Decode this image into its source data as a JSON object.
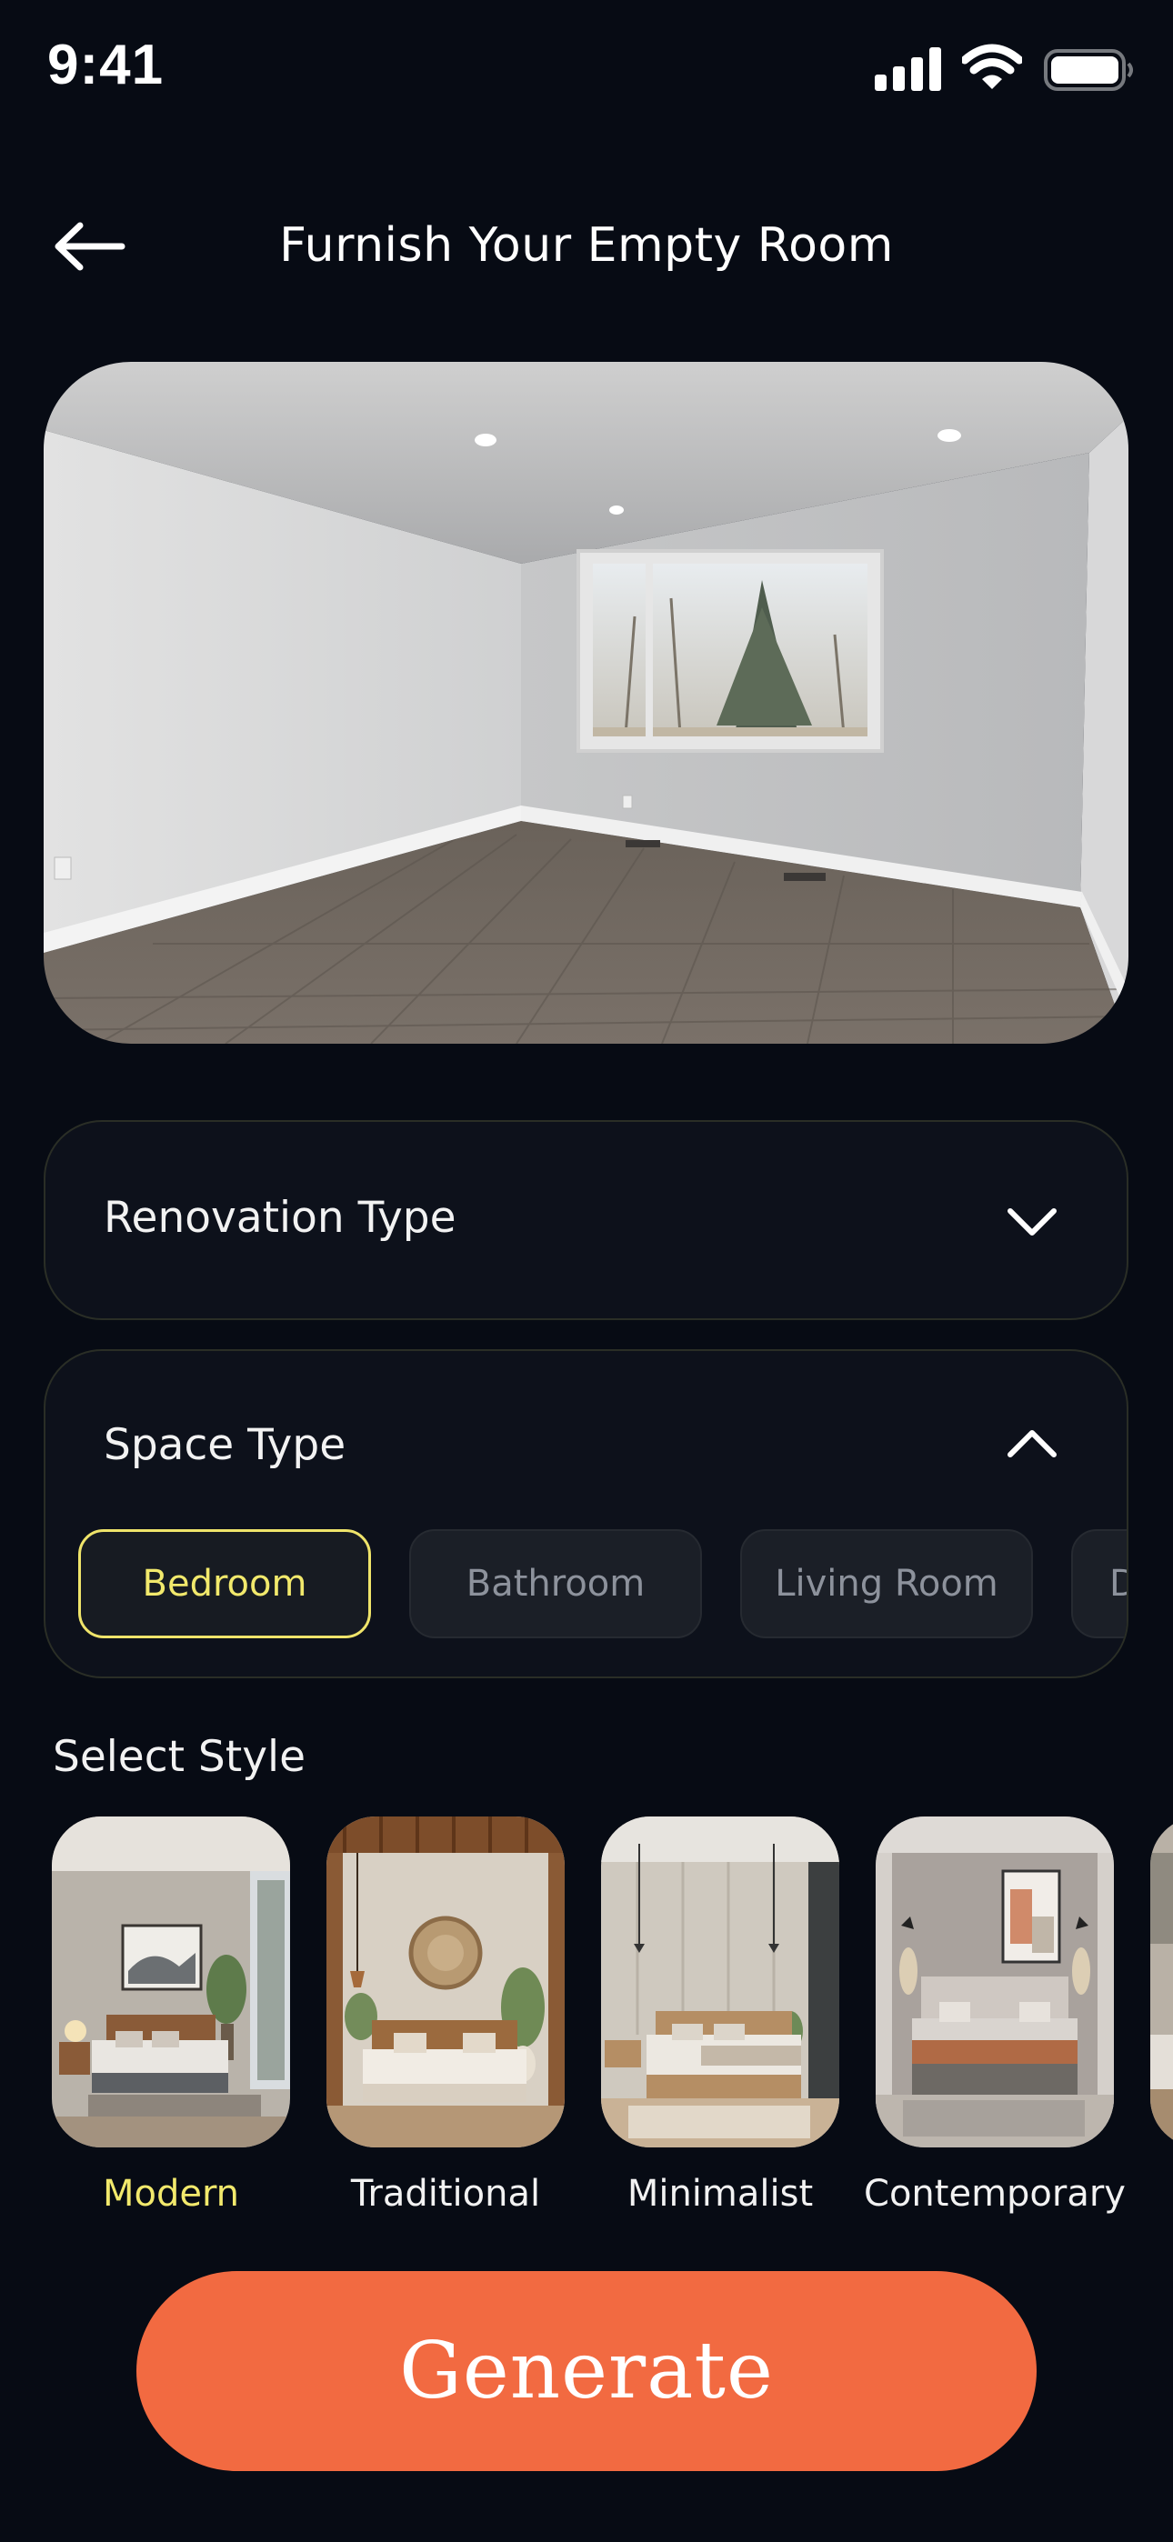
{
  "status_bar": {
    "time": "9:41"
  },
  "header": {
    "title": "Furnish Your Empty Room"
  },
  "renovation": {
    "label": "Renovation Type",
    "expanded": false
  },
  "space": {
    "label": "Space Type",
    "expanded": true,
    "options": [
      "Bedroom",
      "Bathroom",
      "Living Room",
      "D"
    ],
    "selected": "Bedroom"
  },
  "styles": {
    "title": "Select Style",
    "items": [
      {
        "label": "Modern"
      },
      {
        "label": "Traditional"
      },
      {
        "label": "Minimalist"
      },
      {
        "label": "Contemporary"
      }
    ],
    "selected": "Modern"
  },
  "generate": {
    "label": "Generate"
  },
  "colors": {
    "accent": "#f26a41",
    "highlight": "#f2e96c",
    "background": "#070b14",
    "card": "#0d111b"
  }
}
